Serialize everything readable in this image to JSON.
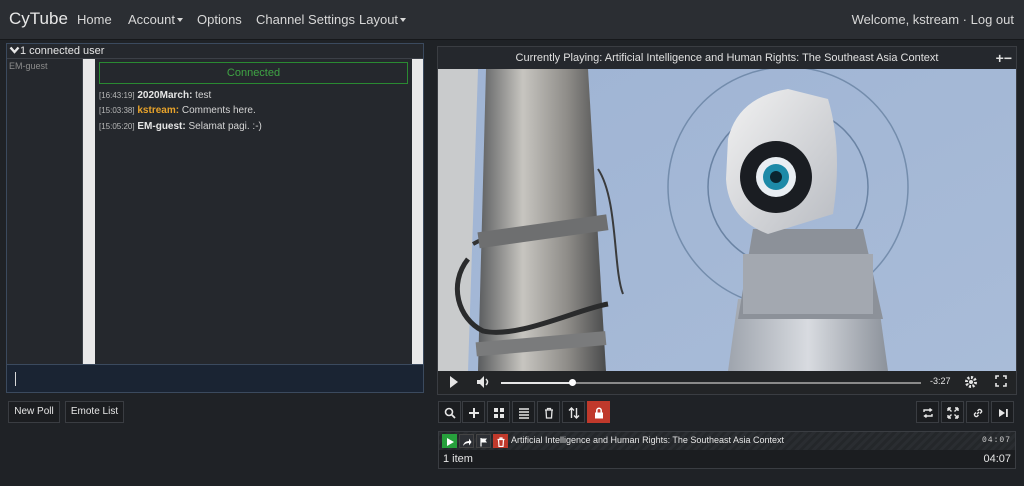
{
  "nav": {
    "brand": "CyTube",
    "home": "Home",
    "account": "Account",
    "options": "Options",
    "channel_settings": "Channel Settings",
    "layout": "Layout",
    "welcome": "Welcome, kstream",
    "separator": "·",
    "logout": "Log out"
  },
  "chat": {
    "user_count_label": "1 connected user",
    "users": [
      "EM-guest"
    ],
    "connected_label": "Connected",
    "messages": [
      {
        "time": "[16:43:19]",
        "user": "2020March:",
        "text": " test",
        "mod": false
      },
      {
        "time": "[15:03:38]",
        "user": "kstream:",
        "text": " Comments here.",
        "mod": true
      },
      {
        "time": "[15:05:20]",
        "user": "EM-guest:",
        "text": " Selamat pagi. :-)",
        "mod": false
      }
    ],
    "input_value": ""
  },
  "buttons": {
    "new_poll": "New Poll",
    "emote_list": "Emote List"
  },
  "video": {
    "title": "Currently Playing: Artificial Intelligence and Human Rights: The Southeast Asia Context",
    "zoom_icons": "+−",
    "progress": 0.17,
    "time_remaining": "-3:27"
  },
  "playlist_toolbar": {
    "left": [
      "search-icon",
      "plus-icon",
      "grid-icon",
      "list-icon",
      "trash-icon",
      "sort-icon",
      "lock-icon"
    ],
    "right": [
      "repeat-icon",
      "shuffle-icon",
      "link-icon",
      "skip-icon"
    ],
    "lock_color": "#c0392b"
  },
  "queue": {
    "items": [
      {
        "title": "Artificial Intelligence and Human Rights: The Southeast Asia Context",
        "duration": "04:07"
      }
    ],
    "count_label": "1 item",
    "total_duration": "04:07"
  },
  "colors": {
    "accent_green": "#27a03c",
    "danger_red": "#c0392b",
    "mod_name": "#e8a32b",
    "connected_green": "#3fa444"
  }
}
